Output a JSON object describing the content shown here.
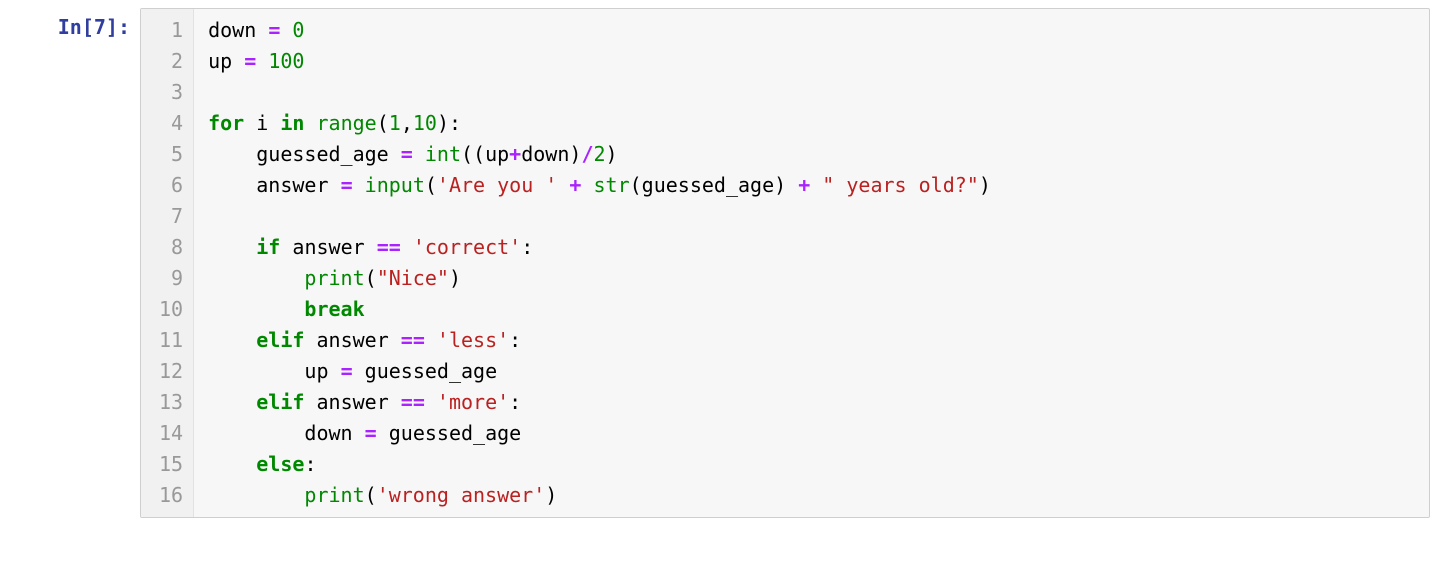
{
  "cell": {
    "prompt": {
      "in": "In",
      "open": "[",
      "num": "7",
      "close": "]:",
      "full": "In [7]:"
    },
    "line_numbers": [
      "1",
      "2",
      "3",
      "4",
      "5",
      "6",
      "7",
      "8",
      "9",
      "10",
      "11",
      "12",
      "13",
      "14",
      "15",
      "16"
    ],
    "code_text_plain": "down = 0\nup = 100\n\nfor i in range(1,10):\n    guessed_age = int((up+down)/2)\n    answer = input('Are you ' + str(guessed_age) + \" years old?\")\n\n    if answer == 'correct':\n        print(\"Nice\")\n        break\n    elif answer == 'less':\n        up = guessed_age\n    elif answer == 'more':\n        down = guessed_age\n    else:\n        print('wrong answer')",
    "tokens": [
      [
        {
          "t": "var",
          "v": "down"
        },
        {
          "t": "sp",
          "v": " "
        },
        {
          "t": "op",
          "v": "="
        },
        {
          "t": "sp",
          "v": " "
        },
        {
          "t": "num",
          "v": "0"
        }
      ],
      [
        {
          "t": "var",
          "v": "up"
        },
        {
          "t": "sp",
          "v": " "
        },
        {
          "t": "op",
          "v": "="
        },
        {
          "t": "sp",
          "v": " "
        },
        {
          "t": "num",
          "v": "100"
        }
      ],
      [],
      [
        {
          "t": "kw",
          "v": "for"
        },
        {
          "t": "sp",
          "v": " "
        },
        {
          "t": "var",
          "v": "i"
        },
        {
          "t": "sp",
          "v": " "
        },
        {
          "t": "kw",
          "v": "in"
        },
        {
          "t": "sp",
          "v": " "
        },
        {
          "t": "bi",
          "v": "range"
        },
        {
          "t": "punc",
          "v": "("
        },
        {
          "t": "num",
          "v": "1"
        },
        {
          "t": "punc",
          "v": ","
        },
        {
          "t": "num",
          "v": "10"
        },
        {
          "t": "punc",
          "v": ")"
        },
        {
          "t": "punc",
          "v": ":"
        }
      ],
      [
        {
          "t": "sp",
          "v": "    "
        },
        {
          "t": "var",
          "v": "guessed_age"
        },
        {
          "t": "sp",
          "v": " "
        },
        {
          "t": "op",
          "v": "="
        },
        {
          "t": "sp",
          "v": " "
        },
        {
          "t": "bi",
          "v": "int"
        },
        {
          "t": "punc",
          "v": "("
        },
        {
          "t": "punc",
          "v": "("
        },
        {
          "t": "var",
          "v": "up"
        },
        {
          "t": "op",
          "v": "+"
        },
        {
          "t": "var",
          "v": "down"
        },
        {
          "t": "punc",
          "v": ")"
        },
        {
          "t": "op",
          "v": "/"
        },
        {
          "t": "num",
          "v": "2"
        },
        {
          "t": "punc",
          "v": ")"
        }
      ],
      [
        {
          "t": "sp",
          "v": "    "
        },
        {
          "t": "var",
          "v": "answer"
        },
        {
          "t": "sp",
          "v": " "
        },
        {
          "t": "op",
          "v": "="
        },
        {
          "t": "sp",
          "v": " "
        },
        {
          "t": "bi",
          "v": "input"
        },
        {
          "t": "punc",
          "v": "("
        },
        {
          "t": "str",
          "v": "'Are you '"
        },
        {
          "t": "sp",
          "v": " "
        },
        {
          "t": "op",
          "v": "+"
        },
        {
          "t": "sp",
          "v": " "
        },
        {
          "t": "bi",
          "v": "str"
        },
        {
          "t": "punc",
          "v": "("
        },
        {
          "t": "var",
          "v": "guessed_age"
        },
        {
          "t": "punc",
          "v": ")"
        },
        {
          "t": "sp",
          "v": " "
        },
        {
          "t": "op",
          "v": "+"
        },
        {
          "t": "sp",
          "v": " "
        },
        {
          "t": "str",
          "v": "\" years old?\""
        },
        {
          "t": "punc",
          "v": ")"
        }
      ],
      [],
      [
        {
          "t": "sp",
          "v": "    "
        },
        {
          "t": "kw",
          "v": "if"
        },
        {
          "t": "sp",
          "v": " "
        },
        {
          "t": "var",
          "v": "answer"
        },
        {
          "t": "sp",
          "v": " "
        },
        {
          "t": "op",
          "v": "=="
        },
        {
          "t": "sp",
          "v": " "
        },
        {
          "t": "str",
          "v": "'correct'"
        },
        {
          "t": "punc",
          "v": ":"
        }
      ],
      [
        {
          "t": "sp",
          "v": "        "
        },
        {
          "t": "bi",
          "v": "print"
        },
        {
          "t": "punc",
          "v": "("
        },
        {
          "t": "str",
          "v": "\"Nice\""
        },
        {
          "t": "punc",
          "v": ")"
        }
      ],
      [
        {
          "t": "sp",
          "v": "        "
        },
        {
          "t": "kw",
          "v": "break"
        }
      ],
      [
        {
          "t": "sp",
          "v": "    "
        },
        {
          "t": "kw",
          "v": "elif"
        },
        {
          "t": "sp",
          "v": " "
        },
        {
          "t": "var",
          "v": "answer"
        },
        {
          "t": "sp",
          "v": " "
        },
        {
          "t": "op",
          "v": "=="
        },
        {
          "t": "sp",
          "v": " "
        },
        {
          "t": "str",
          "v": "'less'"
        },
        {
          "t": "punc",
          "v": ":"
        }
      ],
      [
        {
          "t": "sp",
          "v": "        "
        },
        {
          "t": "var",
          "v": "up"
        },
        {
          "t": "sp",
          "v": " "
        },
        {
          "t": "op",
          "v": "="
        },
        {
          "t": "sp",
          "v": " "
        },
        {
          "t": "var",
          "v": "guessed_age"
        }
      ],
      [
        {
          "t": "sp",
          "v": "    "
        },
        {
          "t": "kw",
          "v": "elif"
        },
        {
          "t": "sp",
          "v": " "
        },
        {
          "t": "var",
          "v": "answer"
        },
        {
          "t": "sp",
          "v": " "
        },
        {
          "t": "op",
          "v": "=="
        },
        {
          "t": "sp",
          "v": " "
        },
        {
          "t": "str",
          "v": "'more'"
        },
        {
          "t": "punc",
          "v": ":"
        }
      ],
      [
        {
          "t": "sp",
          "v": "        "
        },
        {
          "t": "var",
          "v": "down"
        },
        {
          "t": "sp",
          "v": " "
        },
        {
          "t": "op",
          "v": "="
        },
        {
          "t": "sp",
          "v": " "
        },
        {
          "t": "var",
          "v": "guessed_age"
        }
      ],
      [
        {
          "t": "sp",
          "v": "    "
        },
        {
          "t": "kw",
          "v": "else"
        },
        {
          "t": "punc",
          "v": ":"
        }
      ],
      [
        {
          "t": "sp",
          "v": "        "
        },
        {
          "t": "bi",
          "v": "print"
        },
        {
          "t": "punc",
          "v": "("
        },
        {
          "t": "str",
          "v": "'wrong answer'"
        },
        {
          "t": "punc",
          "v": ")"
        }
      ]
    ]
  }
}
